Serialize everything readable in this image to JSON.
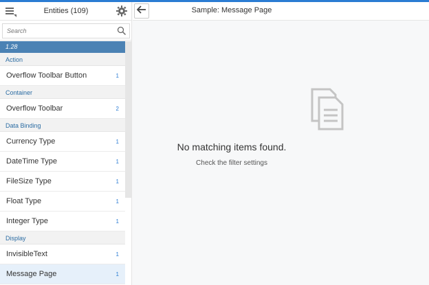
{
  "master": {
    "title": "Entities (109)",
    "search_placeholder": "Search",
    "version": "1.28",
    "groups": [
      {
        "label": "Action",
        "items": [
          {
            "label": "Overflow Toolbar Button",
            "count": "1"
          }
        ]
      },
      {
        "label": "Container",
        "items": [
          {
            "label": "Overflow Toolbar",
            "count": "2"
          }
        ]
      },
      {
        "label": "Data Binding",
        "items": [
          {
            "label": "Currency Type",
            "count": "1"
          },
          {
            "label": "DateTime Type",
            "count": "1"
          },
          {
            "label": "FileSize Type",
            "count": "1"
          },
          {
            "label": "Float Type",
            "count": "1"
          },
          {
            "label": "Integer Type",
            "count": "1"
          }
        ]
      },
      {
        "label": "Display",
        "items": [
          {
            "label": "InvisibleText",
            "count": "1"
          },
          {
            "label": "Message Page",
            "count": "1",
            "selected": true
          }
        ]
      }
    ],
    "icons": {
      "menu": "menu-icon",
      "settings": "gear-icon",
      "search": "search-icon"
    }
  },
  "detail": {
    "title": "Sample: Message Page",
    "empty_title": "No matching items found.",
    "empty_subtitle": "Check the filter settings",
    "icons": {
      "back": "arrow-left-icon",
      "empty": "documents-icon"
    }
  },
  "colors": {
    "accent": "#2b7cd3",
    "version_bar": "#4b82b4",
    "group_text": "#2b6ca3",
    "selected_row": "#e6f0fa"
  }
}
